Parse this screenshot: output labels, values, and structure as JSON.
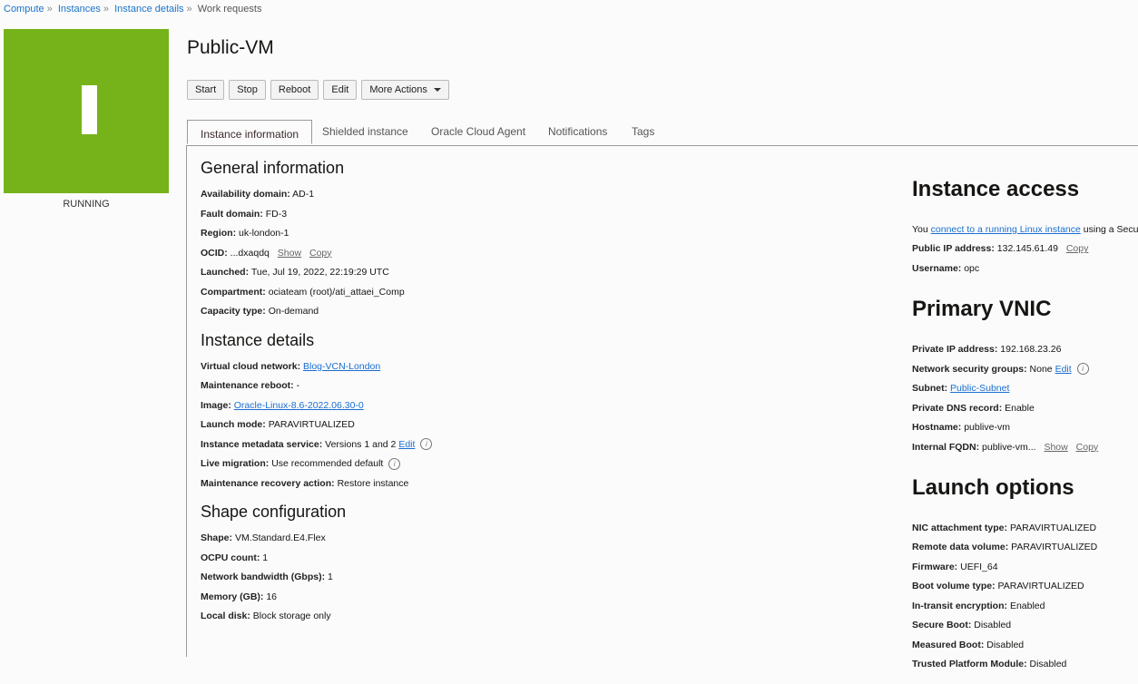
{
  "breadcrumb": [
    "Compute",
    "Instances",
    "Instance details"
  ],
  "breadcrumb_current": "Work requests",
  "breadcrumb_sep": "»",
  "instance": {
    "name": "Public-VM",
    "status": "RUNNING",
    "status_color": "#76b31a",
    "icon_letter": "I"
  },
  "actions": [
    "Start",
    "Stop",
    "Reboot",
    "Edit",
    "More Actions"
  ],
  "tabs": [
    "Instance information",
    "Shielded instance",
    "Oracle Cloud Agent",
    "Notifications",
    "Tags"
  ],
  "left": [
    {
      "title": "General information",
      "rows": [
        {
          "label": "Availability domain:",
          "parts": [
            {
              "t": "text",
              "v": "AD-1"
            }
          ]
        },
        {
          "label": "Fault domain:",
          "parts": [
            {
              "t": "text",
              "v": "FD-3"
            }
          ]
        },
        {
          "label": "Region:",
          "parts": [
            {
              "t": "text",
              "v": "uk-london-1"
            }
          ]
        },
        {
          "label": "OCID:",
          "parts": [
            {
              "t": "text",
              "v": "...dxaqdq"
            },
            {
              "t": "act",
              "v": "Show"
            },
            {
              "t": "act",
              "v": "Copy"
            }
          ]
        },
        {
          "label": "Launched:",
          "parts": [
            {
              "t": "text",
              "v": "Tue, Jul 19, 2022, 22:19:29 UTC"
            }
          ]
        },
        {
          "label": "Compartment:",
          "parts": [
            {
              "t": "text",
              "v": "ociateam (root)/ati_attaei_Comp"
            }
          ]
        },
        {
          "label": "Capacity type:",
          "parts": [
            {
              "t": "text",
              "v": "On-demand"
            }
          ]
        }
      ]
    },
    {
      "title": "Instance details",
      "rows": [
        {
          "label": "Virtual cloud network:",
          "parts": [
            {
              "t": "link",
              "v": "Blog-VCN-London"
            }
          ]
        },
        {
          "label": "Maintenance reboot:",
          "parts": [
            {
              "t": "text",
              "v": "-"
            }
          ]
        },
        {
          "label": "Image:",
          "parts": [
            {
              "t": "link",
              "v": "Oracle-Linux-8.6-2022.06.30-0"
            }
          ]
        },
        {
          "label": "Launch mode:",
          "parts": [
            {
              "t": "text",
              "v": "PARAVIRTUALIZED"
            }
          ]
        },
        {
          "label": "Instance metadata service:",
          "parts": [
            {
              "t": "text",
              "v": "Versions 1 and 2"
            },
            {
              "t": "link",
              "v": "Edit"
            },
            {
              "t": "info",
              "v": "i"
            }
          ]
        },
        {
          "label": "Live migration:",
          "parts": [
            {
              "t": "text",
              "v": "Use recommended default"
            },
            {
              "t": "info",
              "v": "i"
            }
          ]
        },
        {
          "label": "Maintenance recovery action:",
          "parts": [
            {
              "t": "text",
              "v": "Restore instance"
            }
          ]
        }
      ]
    },
    {
      "title": "Shape configuration",
      "rows": [
        {
          "label": "Shape:",
          "parts": [
            {
              "t": "text",
              "v": "VM.Standard.E4.Flex"
            }
          ]
        },
        {
          "label": "OCPU count:",
          "parts": [
            {
              "t": "text",
              "v": "1"
            }
          ]
        },
        {
          "label": "Network bandwidth (Gbps):",
          "parts": [
            {
              "t": "text",
              "v": "1"
            }
          ]
        },
        {
          "label": "Memory (GB):",
          "parts": [
            {
              "t": "text",
              "v": "16"
            }
          ]
        },
        {
          "label": "Local disk:",
          "parts": [
            {
              "t": "text",
              "v": "Block storage only"
            }
          ]
        }
      ]
    }
  ],
  "right": [
    {
      "title": "Instance access",
      "rows": [
        {
          "label": "",
          "parts": [
            {
              "t": "text",
              "v": "You"
            },
            {
              "t": "link",
              "v": "connect to a running Linux instance"
            },
            {
              "t": "text",
              "v": "using a Secur"
            }
          ]
        },
        {
          "label": "Public IP address:",
          "parts": [
            {
              "t": "text",
              "v": "132.145.61.49"
            },
            {
              "t": "act",
              "v": "Copy"
            }
          ]
        },
        {
          "label": "Username:",
          "parts": [
            {
              "t": "text",
              "v": "opc"
            }
          ]
        }
      ]
    },
    {
      "title": "Primary VNIC",
      "rows": [
        {
          "label": "Private IP address:",
          "parts": [
            {
              "t": "text",
              "v": "192.168.23.26"
            }
          ]
        },
        {
          "label": "Network security groups:",
          "parts": [
            {
              "t": "text",
              "v": "None"
            },
            {
              "t": "link",
              "v": "Edit"
            },
            {
              "t": "info",
              "v": "i"
            }
          ]
        },
        {
          "label": "Subnet:",
          "parts": [
            {
              "t": "link",
              "v": "Public-Subnet"
            }
          ]
        },
        {
          "label": "Private DNS record:",
          "parts": [
            {
              "t": "text",
              "v": "Enable"
            }
          ]
        },
        {
          "label": "Hostname:",
          "parts": [
            {
              "t": "text",
              "v": "publive-vm"
            }
          ]
        },
        {
          "label": "Internal FQDN:",
          "parts": [
            {
              "t": "text",
              "v": "publive-vm..."
            },
            {
              "t": "act",
              "v": "Show"
            },
            {
              "t": "act",
              "v": "Copy"
            }
          ]
        }
      ]
    },
    {
      "title": "Launch options",
      "rows": [
        {
          "label": "NIC attachment type:",
          "parts": [
            {
              "t": "text",
              "v": "PARAVIRTUALIZED"
            }
          ]
        },
        {
          "label": "Remote data volume:",
          "parts": [
            {
              "t": "text",
              "v": "PARAVIRTUALIZED"
            }
          ]
        },
        {
          "label": "Firmware:",
          "parts": [
            {
              "t": "text",
              "v": "UEFI_64"
            }
          ]
        },
        {
          "label": "Boot volume type:",
          "parts": [
            {
              "t": "text",
              "v": "PARAVIRTUALIZED"
            }
          ]
        },
        {
          "label": "In-transit encryption:",
          "parts": [
            {
              "t": "text",
              "v": "Enabled"
            }
          ]
        },
        {
          "label": "Secure Boot:",
          "parts": [
            {
              "t": "text",
              "v": "Disabled"
            }
          ]
        },
        {
          "label": "Measured Boot:",
          "parts": [
            {
              "t": "text",
              "v": "Disabled"
            }
          ]
        },
        {
          "label": "Trusted Platform Module:",
          "parts": [
            {
              "t": "text",
              "v": "Disabled"
            }
          ]
        }
      ]
    }
  ]
}
